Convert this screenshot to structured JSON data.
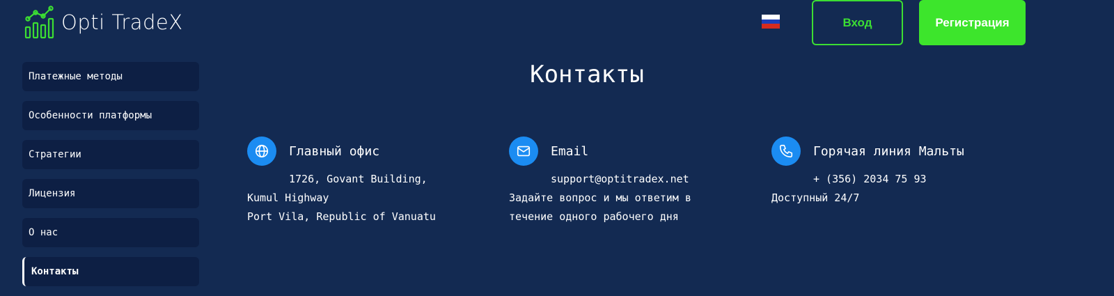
{
  "header": {
    "logo_text": "Opti TradeX",
    "language_flag": "russian-flag",
    "login_label": "Вход",
    "register_label": "Регистрация",
    "accent_color": "#3de52c"
  },
  "sidebar": {
    "items": [
      {
        "label": "Платежные методы"
      },
      {
        "label": "Особенности платформы"
      },
      {
        "label": "Стратегии"
      },
      {
        "label": "Лицензия"
      },
      {
        "label": "О нас"
      },
      {
        "label": "Контакты",
        "active": true
      }
    ]
  },
  "main": {
    "title": "Контакты",
    "contacts": [
      {
        "icon": "globe-icon",
        "title": "Главный офис",
        "lines": [
          "1726, Govant Building,",
          "Kumul Highway",
          "Port Vila, Republic of Vanuatu"
        ]
      },
      {
        "icon": "mail-icon",
        "title": "Email",
        "lines": [
          "support@optitradex.net",
          "Задайте вопрос и мы ответим в",
          "течение одного рабочего дня"
        ]
      },
      {
        "icon": "phone-icon",
        "title": "Горячая линия Мальты",
        "lines": [
          "+ (356) 2034 75 93",
          "Доступный 24/7"
        ]
      }
    ]
  }
}
